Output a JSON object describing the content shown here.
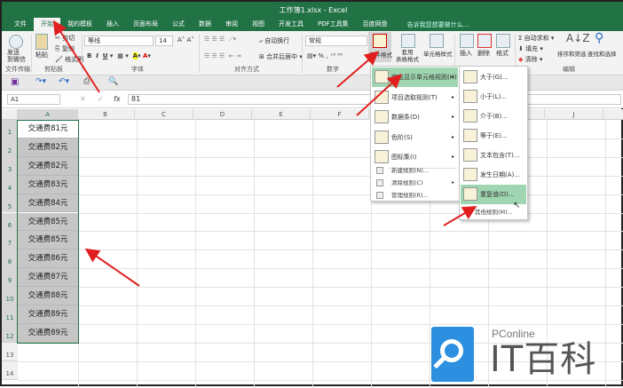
{
  "window": {
    "title": "工作簿1.xlsx - Excel"
  },
  "tabs": [
    "文件",
    "开始",
    "我的模板",
    "插入",
    "页面布局",
    "公式",
    "数据",
    "审阅",
    "视图",
    "开发工具",
    "PDF工具集",
    "百度网盘"
  ],
  "active_tab": "开始",
  "tell_me": "告诉我您想要做什么...",
  "ribbon": {
    "send": "发送\n到微信",
    "send_group": "文件传输",
    "paste": "粘贴",
    "cut": "剪切",
    "copy": "复制",
    "format_painter": "格式刷",
    "clipboard_group": "剪贴板",
    "font_name": "等线",
    "font_size": "14",
    "font_group": "字体",
    "wrap": "自动换行",
    "merge": "合并后居中",
    "align_group": "对齐方式",
    "number_format": "常规",
    "number_group": "数字",
    "cond_format": "条件格式",
    "table_format": "套用\n表格格式",
    "cell_style": "单元格样式",
    "insert": "插入",
    "delete": "删除",
    "format": "格式",
    "autosum": "自动求和",
    "fill": "填充",
    "clear": "清除",
    "edit_group": "编辑",
    "sort": "排序和筛选",
    "find": "查找和选择"
  },
  "formula_bar": {
    "name_box": "A1",
    "value": "81",
    "fx": "fx"
  },
  "columns": [
    "A",
    "B",
    "C",
    "D",
    "E",
    "F",
    "G",
    "H",
    "I",
    "J"
  ],
  "rows": [
    "1",
    "2",
    "3",
    "4",
    "5",
    "6",
    "7",
    "8",
    "9",
    "10",
    "11",
    "12",
    "13",
    "14"
  ],
  "cells": [
    "交通费81元",
    "交通费82元",
    "交通费82元",
    "交通费83元",
    "交通费84元",
    "交通费85元",
    "交通费85元",
    "交通费86元",
    "交通费87元",
    "交通费88元",
    "交通费89元",
    "交通费89元"
  ],
  "cond_menu": {
    "items": [
      "突出显示单元格规则(H)",
      "项目选取规则(T)",
      "数据条(D)",
      "色阶(S)",
      "图标集(I)"
    ],
    "small": [
      "新建规则(N)...",
      "清除规则(C)",
      "管理规则(R)..."
    ]
  },
  "sub_menu": {
    "items": [
      "大于(G)...",
      "小于(L)...",
      "介于(B)...",
      "等于(E)...",
      "文本包含(T)...",
      "发生日期(A)...",
      "重复值(D)..."
    ],
    "more": "其他规则(M)..."
  },
  "logo": {
    "text1": "PConline",
    "text2": "IT百科"
  },
  "colors": {
    "accent": "#217346",
    "highlight": "#9fd5b0",
    "arrow": "#e02020",
    "selection": "#c6c6c6",
    "logo": "#2d8fe0"
  }
}
